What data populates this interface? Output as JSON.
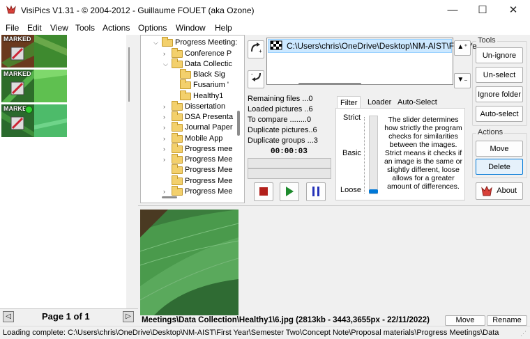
{
  "window": {
    "title": "VisiPics V1.31 - © 2004-2012 - Guillaume FOUET (aka Ozone)",
    "minimize": "—",
    "maximize": "☐",
    "close": "✕"
  },
  "menu": [
    "File",
    "Edit",
    "View",
    "Tools",
    "Actions",
    "Options",
    "Window",
    "Help"
  ],
  "thumbnails": {
    "marked_label": "MARKED"
  },
  "page": {
    "label": "Page 1 of 1"
  },
  "tree": [
    {
      "label": "Progress Meeting:",
      "expanded": true
    },
    {
      "label": "Conference P"
    },
    {
      "label": "Data Collectic",
      "expanded": true
    },
    {
      "label": "Black Sig"
    },
    {
      "label": "Fusarium '"
    },
    {
      "label": "Healthy1"
    },
    {
      "label": "Dissertation"
    },
    {
      "label": "DSA Presenta"
    },
    {
      "label": "Journal Paper"
    },
    {
      "label": "Mobile App"
    },
    {
      "label": "Progress mee"
    },
    {
      "label": "Progress Mee"
    },
    {
      "label": "Progress Mee"
    },
    {
      "label": "Progress Mee"
    },
    {
      "label": "Progress Mee"
    }
  ],
  "filelist": {
    "path": "C:\\Users\\chris\\OneDrive\\Desktop\\NM-AIST\\First Ye"
  },
  "stats": {
    "remaining": "Remaining files ...0",
    "loaded": "Loaded pictures ..6",
    "compare": "To compare ........0",
    "duplicates": "Duplicate pictures..6",
    "groups": "Duplicate groups ...3",
    "timer": "00:00:03"
  },
  "tabs": {
    "filter": "Filter",
    "loader": "Loader",
    "autoselect": "Auto-Select"
  },
  "filter": {
    "strict": "Strict",
    "basic": "Basic",
    "loose": "Loose",
    "level": 0.0,
    "description": "The slider determines how strictly the program checks for similarities between the images. Strict means it checks if an image is the same or slightly different, loose allows for a greater amount of differences."
  },
  "tools": {
    "title": "Tools",
    "unignore": "Un-ignore",
    "unselect": "Un-select",
    "ignore_folder": "Ignore folder",
    "autoselect": "Auto-select"
  },
  "actions": {
    "title": "Actions",
    "move": "Move",
    "delete": "Delete",
    "about": "About"
  },
  "info": {
    "text": "Meetings\\Data Collection\\Healthy1\\6.jpg (2813kb - 3443,3655px - 22/11/2022)",
    "move": "Move",
    "rename": "Rename"
  },
  "status": {
    "text": "Loading complete: C:\\Users\\chris\\OneDrive\\Desktop\\NM-AIST\\First Year\\Semester Two\\Concept Note\\Proposal materials\\Progress Meetings\\Data"
  },
  "colors": {
    "accent": "#0078d7",
    "leaf_dark": "#2c6b2a",
    "leaf_light": "#6fd460"
  }
}
